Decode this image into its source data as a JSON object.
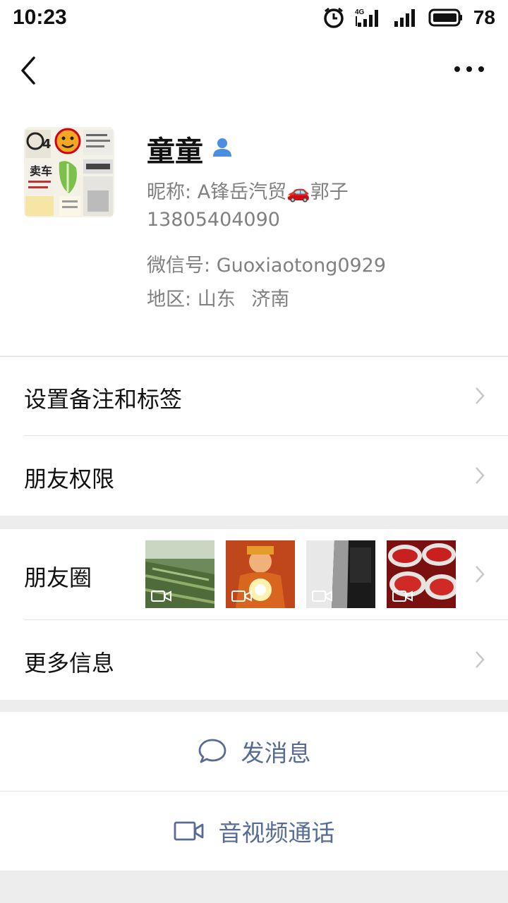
{
  "status_bar": {
    "time": "10:23",
    "network": "4G",
    "battery": "78"
  },
  "nav": {
    "back_icon": "chevron-left",
    "more_icon": "ellipsis"
  },
  "profile": {
    "name": "童童",
    "nickname_label": "昵称:",
    "nickname": "A锋岳汽贸🚗郭子",
    "phone": "13805404090",
    "wechat_id_label": "微信号:",
    "wechat_id": "Guoxiaotong0929",
    "region_label": "地区:",
    "region_province": "山东",
    "region_city": "济南",
    "badge_icon": "person-icon"
  },
  "rows": {
    "remark_tags": "设置备注和标签",
    "friend_permissions": "朋友权限",
    "moments": "朋友圈",
    "more_info": "更多信息"
  },
  "actions": {
    "send_message": "发消息",
    "video_call": "音视频通话"
  },
  "colors": {
    "link_blue": "#576b95",
    "secondary_text": "#808080",
    "background": "#ededed"
  }
}
